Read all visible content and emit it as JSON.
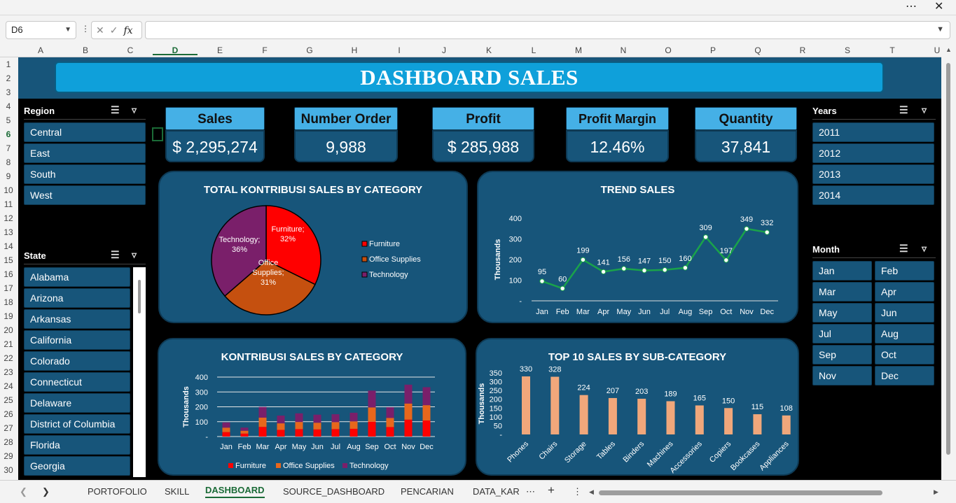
{
  "namebox": {
    "cell": "D6"
  },
  "columns": [
    "A",
    "B",
    "C",
    "D",
    "E",
    "F",
    "G",
    "H",
    "I",
    "J",
    "K",
    "L",
    "M",
    "N",
    "O",
    "P",
    "Q",
    "R",
    "S",
    "T",
    "U"
  ],
  "rows": [
    "1",
    "2",
    "3",
    "4",
    "5",
    "6",
    "7",
    "8",
    "9",
    "10",
    "11",
    "12",
    "13",
    "14",
    "15",
    "16",
    "17",
    "18",
    "19",
    "20",
    "21",
    "22",
    "23",
    "24",
    "25",
    "26",
    "27",
    "28",
    "29",
    "30"
  ],
  "title": "DASHBOARD SALES",
  "cards": [
    {
      "label": "Sales",
      "value": "$ 2,295,274"
    },
    {
      "label": "Number Order",
      "value": "9,988"
    },
    {
      "label": "Profit",
      "value": "$ 285,988"
    },
    {
      "label": "Profit Margin",
      "value": "12.46%"
    },
    {
      "label": "Quantity",
      "value": "37,841"
    }
  ],
  "region_slicer": {
    "title": "Region",
    "items": [
      "Central",
      "East",
      "South",
      "West"
    ]
  },
  "state_slicer": {
    "title": "State",
    "items": [
      "Alabama",
      "Arizona",
      "Arkansas",
      "California",
      "Colorado",
      "Connecticut",
      "Delaware",
      "District of Columbia",
      "Florida",
      "Georgia"
    ]
  },
  "years_slicer": {
    "title": "Years",
    "items": [
      "2011",
      "2012",
      "2013",
      "2014"
    ]
  },
  "month_slicer": {
    "title": "Month",
    "items": [
      "Jan",
      "Feb",
      "Mar",
      "Apr",
      "May",
      "Jun",
      "Jul",
      "Aug",
      "Sep",
      "Oct",
      "Nov",
      "Dec"
    ]
  },
  "tabs": [
    "PORTOFOLIO",
    "SKILL",
    "DASHBOARD",
    "SOURCE_DASHBOARD",
    "PENCARIAN",
    "DATA_KAR"
  ],
  "active_tab": "DASHBOARD",
  "colors": {
    "sheet_bg": "#000000",
    "panel": "#17557a",
    "banner": "#0fa0da",
    "furniture": "#ff0000",
    "office": "#c5500f",
    "technology": "#7a1f6a",
    "trend_line": "#1aa34a",
    "bar": "#f0a77b"
  },
  "chart_data": [
    {
      "type": "pie",
      "title": "TOTAL KONTRIBUSI SALES BY CATEGORY",
      "slice_labels": [
        "Furniture;\n32%",
        "Office\nSupplies;\n31%",
        "Technology;\n36%"
      ],
      "slices": [
        {
          "name": "Furniture",
          "value": 32,
          "color": "#ff0000"
        },
        {
          "name": "Office Supplies",
          "value": 31,
          "color": "#c5500f"
        },
        {
          "name": "Technology",
          "value": 36,
          "color": "#7a1f6a"
        }
      ],
      "legend": [
        "Furniture",
        "Office Supplies",
        "Technology"
      ],
      "legend_position": "right"
    },
    {
      "type": "line",
      "title": "TREND SALES",
      "ylabel": "Thousands",
      "categories": [
        "Jan",
        "Feb",
        "Mar",
        "Apr",
        "May",
        "Jun",
        "Jul",
        "Aug",
        "Sep",
        "Oct",
        "Nov",
        "Dec"
      ],
      "values": [
        95,
        60,
        199,
        141,
        156,
        147,
        150,
        160,
        309,
        197,
        349,
        332
      ],
      "yticks": [
        "-",
        "100",
        "200",
        "300",
        "400"
      ],
      "ylim": [
        0,
        400
      ]
    },
    {
      "type": "bar",
      "stacked": true,
      "title": "KONTRIBUSI SALES BY CATEGORY",
      "ylabel": "Thousands",
      "categories": [
        "Jan",
        "Feb",
        "Mar",
        "Apr",
        "May",
        "Jun",
        "Jul",
        "Aug",
        "Sep",
        "Oct",
        "Nov",
        "Dec"
      ],
      "series": [
        {
          "name": "Furniture",
          "color": "#ff0000",
          "values": [
            30,
            20,
            65,
            45,
            50,
            48,
            50,
            52,
            100,
            64,
            114,
            108
          ]
        },
        {
          "name": "Office Supplies",
          "color": "#e8671c",
          "values": [
            30,
            19,
            62,
            44,
            48,
            45,
            47,
            50,
            96,
            61,
            108,
            103
          ]
        },
        {
          "name": "Technology",
          "color": "#7a1f6a",
          "values": [
            35,
            21,
            72,
            52,
            58,
            54,
            53,
            58,
            113,
            72,
            127,
            121
          ]
        }
      ],
      "yticks": [
        "-",
        "100",
        "200",
        "300",
        "400"
      ],
      "ylim": [
        0,
        400
      ],
      "legend_position": "bottom"
    },
    {
      "type": "bar",
      "title": "TOP 10 SALES BY SUB-CATEGORY",
      "ylabel": "Thousands",
      "categories": [
        "Phones",
        "Chairs",
        "Storage",
        "Tables",
        "Binders",
        "Machines",
        "Accessories",
        "Copiers",
        "Bookcases",
        "Appliances"
      ],
      "values": [
        330,
        328,
        224,
        207,
        203,
        189,
        165,
        150,
        115,
        108
      ],
      "yticks": [
        "-",
        "50",
        "100",
        "150",
        "200",
        "250",
        "300",
        "350"
      ],
      "ylim": [
        0,
        350
      ]
    }
  ]
}
